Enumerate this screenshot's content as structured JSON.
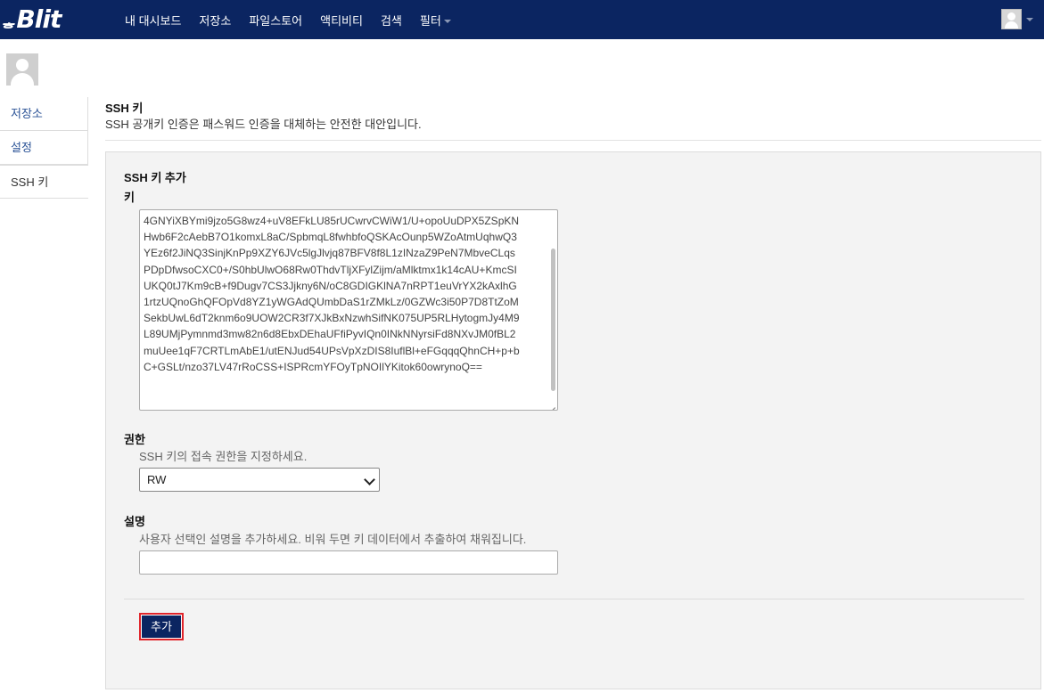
{
  "header": {
    "logo_mark": "ᇂ",
    "logo_text": "Blit",
    "nav": [
      "내 대시보드",
      "저장소",
      "파일스토어",
      "액티비티",
      "검색",
      "필터"
    ],
    "bg_color": "#0b2561"
  },
  "sidebar": {
    "items": [
      {
        "label": "저장소",
        "active": false
      },
      {
        "label": "설정",
        "active": false
      },
      {
        "label": "SSH 키",
        "active": true
      }
    ]
  },
  "page": {
    "title": "SSH 키",
    "description": "SSH 공개키 인증은 패스워드 인증을 대체하는 안전한 대안입니다."
  },
  "form": {
    "title": "SSH 키 추가",
    "key_label": "키",
    "key_lines": [
      "4GNYiXBYmi9jzo5G8wz4+uV8EFkLU85rUCwrvCWiW1/U+opoUuDPX5ZSpKN",
      "Hwb6F2cAebB7O1komxL8aC/SpbmqL8fwhbfoQSKAcOunp5WZoAtmUqhwQ3",
      "YEz6f2JiNQ3SinjKnPp9XZY6JVc5lgJlvjq87BFV8f8L1zINzaZ9PeN7MbveCLqs",
      "PDpDfwsoCXC0+/S0hbUlwO68Rw0ThdvTljXFylZijm/aMlktmx1k14cAU+KmcSI",
      "UKQ0tJ7Km9cB+f9Dugv7CS3Jjkny6N/oC8GDIGKlNA7nRPT1euVrYX2kAxlhG",
      "1rtzUQnoGhQFOpVd8YZ1yWGAdQUmbDaS1rZMkLz/0GZWc3i50P7D8TtZoM",
      "SekbUwL6dT2knm6o9UOW2CR3f7XJkBxNzwhSifNK075UP5RLHytogmJy4M9",
      "L89UMjPymnmd3mw82n6d8EbxDEhaUFfiPyvIQn0INkNNyrsiFd8NXvJM0fBL2",
      "muUee1qF7CRTLmAbE1/utENJud54UPsVpXzDIS8IuflBl+eFGqqqQhnCH+p+b",
      "C+GSLt/nzo37LV47rRoCSS+ISPRcmYFOyTpNOIlYKitok60owrynoQ=="
    ],
    "permission_label": "권한",
    "permission_help": "SSH 키의 접속 권한을 지정하세요.",
    "permission_value": "RW",
    "description_label": "설명",
    "description_help": "사용자 선택인 설명을 추가하세요. 비워 두면 키 데이터에서 추출하여 채워집니다.",
    "description_value": "",
    "submit_label": "추가"
  }
}
